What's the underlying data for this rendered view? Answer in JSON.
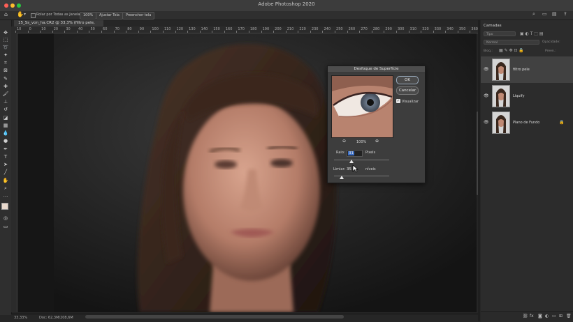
{
  "app": {
    "title": "Adobe Photoshop 2020",
    "zoom_status": "33,33%",
    "doc_status": "Doc: 62,3M/208,6M"
  },
  "options_bar": {
    "scroll_all_label": "Rolar por Todas as Janelas",
    "zoom_100": "100%",
    "fit_screen": "Ajustar Tela",
    "fill_screen": "Preencher tela"
  },
  "document": {
    "tab_label": "15_Ss_von_ha.CR2 @ 33,3% (filtro pele, RGB/8) *"
  },
  "ruler": {
    "ticks": [
      "10",
      "0",
      "10",
      "20",
      "30",
      "40",
      "50",
      "60",
      "70",
      "80",
      "90",
      "100",
      "110",
      "120",
      "130",
      "140",
      "150",
      "160",
      "170",
      "180",
      "190",
      "200",
      "210",
      "220",
      "230",
      "240",
      "250",
      "260",
      "270",
      "280",
      "290",
      "300",
      "310",
      "320",
      "330",
      "340",
      "350",
      "360"
    ]
  },
  "layers_panel": {
    "title": "Camadas",
    "search_placeholder": "Tipo",
    "blend_mode": "Normal",
    "opacity_label": "Opacidade:",
    "lock_label": "Bloq.:",
    "fill_label": "Preen.:",
    "layers": [
      {
        "name": "filtro pele",
        "visible": true,
        "selected": true
      },
      {
        "name": "Liquify",
        "visible": true,
        "selected": false
      },
      {
        "name": "Plano de Fundo",
        "visible": true,
        "selected": false,
        "locked": true
      }
    ],
    "footer_icons": [
      "link-icon",
      "fx-icon",
      "mask-icon",
      "adjustment-icon",
      "group-icon",
      "new-layer-icon",
      "trash-icon"
    ]
  },
  "dialog": {
    "title": "Desfoque de Superfície",
    "ok_label": "OK",
    "cancel_label": "Cancelar",
    "preview_label": "Visualizar",
    "preview_checked": true,
    "zoom_label": "100%",
    "radius": {
      "label": "Raio:",
      "value": "31",
      "unit": "Pixels",
      "level": 0.32
    },
    "threshold": {
      "label": "Limiar:",
      "value": "35",
      "unit": "níveis",
      "level": 0.14
    }
  },
  "colors": {
    "accent": "#4a7fd4",
    "panel_bg": "#2c2c2c",
    "dialog_bg": "#3d3d3d"
  }
}
